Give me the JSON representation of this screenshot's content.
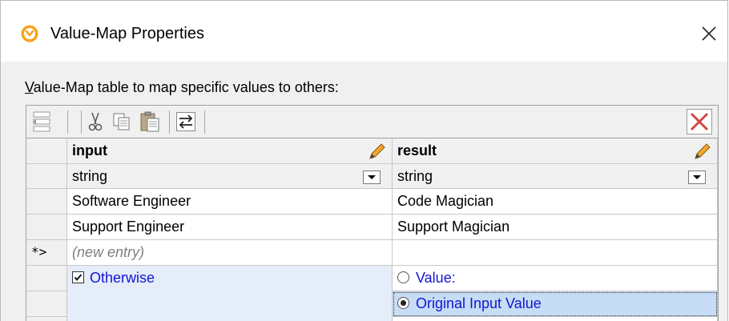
{
  "window": {
    "title": "Value-Map Properties"
  },
  "caption": {
    "mnemonic": "V",
    "rest": "alue-Map table to map specific values to others:"
  },
  "toolbar": {
    "buttons": [
      "insert-row-icon",
      "cut-icon",
      "copy-icon",
      "paste-icon",
      "swap-columns-icon",
      "delete-icon"
    ]
  },
  "table": {
    "columns": [
      {
        "header": "input",
        "type": "string"
      },
      {
        "header": "result",
        "type": "string"
      }
    ],
    "rows": [
      {
        "input": "Software Engineer",
        "result": "Code Magician"
      },
      {
        "input": "Support Engineer",
        "result": "Support Magician"
      }
    ],
    "new_entry_marker": "*>",
    "new_entry_placeholder": "(new entry)"
  },
  "otherwise": {
    "label": "Otherwise",
    "checked": true,
    "options": [
      {
        "label": "Value:",
        "selected": false
      },
      {
        "label": "Original Input Value",
        "selected": true
      }
    ]
  }
}
